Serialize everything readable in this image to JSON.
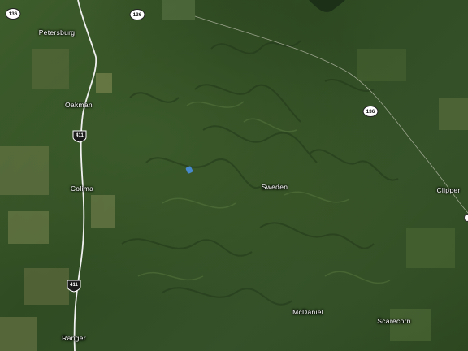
{
  "map": {
    "view": "satellite",
    "places": [
      {
        "id": "petersburg",
        "label": "Petersburg"
      },
      {
        "id": "oakman",
        "label": "Oakman"
      },
      {
        "id": "colima",
        "label": "Colima"
      },
      {
        "id": "ranger",
        "label": "Ranger"
      },
      {
        "id": "sweden",
        "label": "Sweden"
      },
      {
        "id": "clipper",
        "label": "Clipper"
      },
      {
        "id": "mcdaniel",
        "label": "McDaniel"
      },
      {
        "id": "scarecorn",
        "label": "Scarecorn"
      }
    ],
    "route_shields": [
      {
        "id": "sh136a",
        "type": "state",
        "number": "136"
      },
      {
        "id": "sh136b",
        "type": "state",
        "number": "136"
      },
      {
        "id": "sh136c",
        "type": "state",
        "number": "136"
      },
      {
        "id": "us411a",
        "type": "us",
        "number": "411"
      },
      {
        "id": "us411b",
        "type": "us",
        "number": "411"
      }
    ],
    "colors": {
      "road": "#f2f2f2",
      "water": "#4a8fe0",
      "vegetation": "#3a5a28"
    }
  }
}
